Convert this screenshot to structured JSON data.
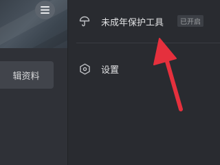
{
  "profile": {
    "edit_button_label": "辑资料",
    "menu_icon": "hamburger-icon"
  },
  "settings": {
    "items": [
      {
        "label": "未成年保护工具",
        "badge": "已开启",
        "icon": "umbrella-icon"
      },
      {
        "label": "设置",
        "icon": "hexagon-settings-icon"
      }
    ]
  },
  "annotation": {
    "color": "#e5303d",
    "icon": "red-arrow"
  }
}
